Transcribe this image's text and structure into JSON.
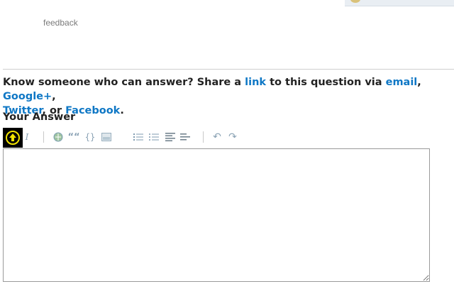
{
  "header": {
    "feedback_label": "feedback"
  },
  "share": {
    "prefix": "Know someone who can answer? Share a ",
    "link_label": "link",
    "middle": " to this question via ",
    "email_label": "email",
    "comma1": ", ",
    "google_label": "Google+",
    "comma2": ",",
    "twitter_label": "Twitter",
    "or_text": ", or ",
    "facebook_label": "Facebook",
    "period": "."
  },
  "answer": {
    "title": "Your Answer",
    "editor_value": ""
  },
  "toolbar": {
    "buttons": [
      {
        "name": "upload-icon"
      },
      {
        "name": "italic-icon",
        "glyph": "I"
      },
      {
        "name": "hyperlink-icon"
      },
      {
        "name": "blockquote-icon",
        "glyph": "““"
      },
      {
        "name": "code-icon",
        "glyph": "{}"
      },
      {
        "name": "image-icon"
      },
      {
        "name": "numbered-list-icon"
      },
      {
        "name": "bulleted-list-icon"
      },
      {
        "name": "heading-icon"
      },
      {
        "name": "horizontal-rule-icon"
      },
      {
        "name": "undo-icon",
        "glyph": "↶"
      },
      {
        "name": "redo-icon",
        "glyph": "↷"
      }
    ]
  },
  "colors": {
    "link": "#0e77c5",
    "icon": "#8ba3b5",
    "upload_bg": "#000000",
    "upload_accent": "#f2e300"
  }
}
